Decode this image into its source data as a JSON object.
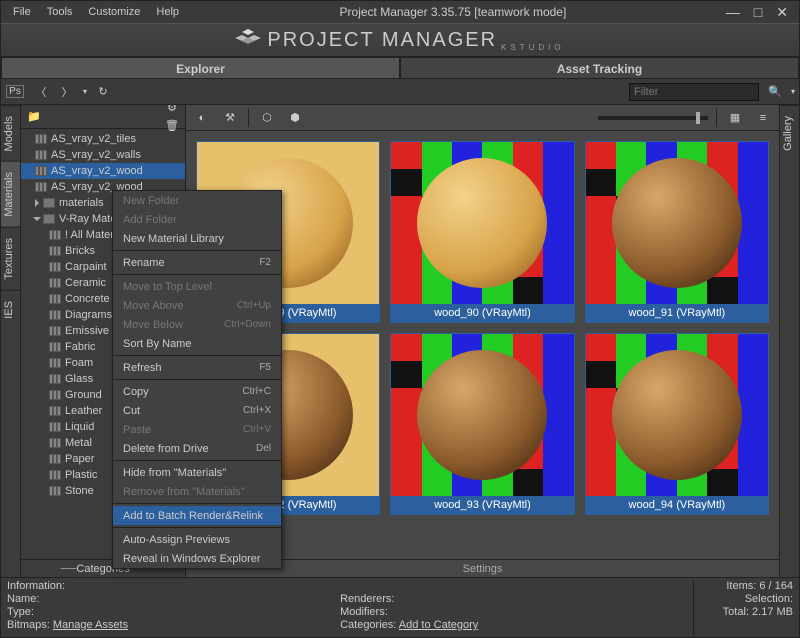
{
  "window": {
    "title": "Project Manager 3.35.75  [teamwork mode]",
    "menu": [
      "File",
      "Tools",
      "Customize",
      "Help"
    ],
    "logo_text": "PROJECT MANAGER",
    "logo_sub": "KSTUDIO"
  },
  "main_tabs": {
    "explorer": "Explorer",
    "asset_tracking": "Asset Tracking",
    "active": "explorer"
  },
  "nav": {
    "filter_placeholder": "Filter"
  },
  "side_tabs": {
    "left": [
      "Models",
      "Materials",
      "Textures",
      "IES"
    ],
    "left_active": 1,
    "right": [
      "Gallery"
    ]
  },
  "tree": {
    "items": [
      {
        "level": 0,
        "label": "AS_vray_v2_tiles",
        "icon": "mat"
      },
      {
        "level": 0,
        "label": "AS_vray_v2_walls",
        "icon": "mat"
      },
      {
        "level": 0,
        "label": "AS_vray_v2_wood",
        "icon": "mat",
        "selected": true
      },
      {
        "level": 0,
        "label": "AS_vray_v2_wood",
        "icon": "mat"
      },
      {
        "level": 0,
        "label": "materials",
        "icon": "folder",
        "expander": "closed"
      },
      {
        "level": 0,
        "label": "V-Ray Materials",
        "icon": "folder",
        "expander": "open"
      },
      {
        "level": 1,
        "label": "! All Materials",
        "icon": "mat"
      },
      {
        "level": 1,
        "label": "Bricks",
        "icon": "mat"
      },
      {
        "level": 1,
        "label": "Carpaint",
        "icon": "mat"
      },
      {
        "level": 1,
        "label": "Ceramic",
        "icon": "mat"
      },
      {
        "level": 1,
        "label": "Concrete",
        "icon": "mat"
      },
      {
        "level": 1,
        "label": "Diagrams",
        "icon": "mat"
      },
      {
        "level": 1,
        "label": "Emissive",
        "icon": "mat"
      },
      {
        "level": 1,
        "label": "Fabric",
        "icon": "mat"
      },
      {
        "level": 1,
        "label": "Foam",
        "icon": "mat"
      },
      {
        "level": 1,
        "label": "Glass",
        "icon": "mat"
      },
      {
        "level": 1,
        "label": "Ground",
        "icon": "mat"
      },
      {
        "level": 1,
        "label": "Leather",
        "icon": "mat"
      },
      {
        "level": 1,
        "label": "Liquid",
        "icon": "mat"
      },
      {
        "level": 1,
        "label": "Metal",
        "icon": "mat"
      },
      {
        "level": 1,
        "label": "Paper",
        "icon": "mat"
      },
      {
        "level": 1,
        "label": "Plastic",
        "icon": "mat"
      },
      {
        "level": 1,
        "label": "Stone",
        "icon": "mat"
      }
    ],
    "categories_label": "Categories"
  },
  "thumbs": {
    "settings_label": "Settings",
    "items": [
      {
        "caption": "wood_89 (VRayMtl)",
        "bg": "plain",
        "sphere": "light"
      },
      {
        "caption": "wood_90 (VRayMtl)",
        "bg": "checker",
        "sphere": "light"
      },
      {
        "caption": "wood_91 (VRayMtl)",
        "bg": "checker",
        "sphere": "dark"
      },
      {
        "caption": "wood_92 (VRayMtl)",
        "bg": "plain",
        "sphere": "dark"
      },
      {
        "caption": "wood_93 (VRayMtl)",
        "bg": "checker",
        "sphere": "dark"
      },
      {
        "caption": "wood_94 (VRayMtl)",
        "bg": "checker",
        "sphere": "dark"
      }
    ]
  },
  "info": {
    "header": "Information:",
    "name": "Name:",
    "type": "Type:",
    "bitmaps": "Bitmaps:",
    "manage_assets": "Manage Assets",
    "renderers": "Renderers:",
    "modifiers": "Modifiers:",
    "categories": "Categories:",
    "add_to_category": "Add to Category",
    "items_label": "Items:",
    "items_value": "6 / 164",
    "selection_label": "Selection:",
    "selection_value": "",
    "total_label": "Total:",
    "total_value": "2.17 MB"
  },
  "context_menu": {
    "highlight": 18,
    "items": [
      {
        "label": "New Folder",
        "disabled": true
      },
      {
        "label": "Add Folder",
        "disabled": true
      },
      {
        "label": "New Material Library"
      },
      {
        "sep": true
      },
      {
        "label": "Rename",
        "shortcut": "F2"
      },
      {
        "sep": true
      },
      {
        "label": "Move to Top Level",
        "disabled": true
      },
      {
        "label": "Move Above",
        "shortcut": "Ctrl+Up",
        "disabled": true
      },
      {
        "label": "Move Below",
        "shortcut": "Ctrl+Down",
        "disabled": true
      },
      {
        "label": "Sort By Name"
      },
      {
        "sep": true
      },
      {
        "label": "Refresh",
        "shortcut": "F5"
      },
      {
        "sep": true
      },
      {
        "label": "Copy",
        "shortcut": "Ctrl+C"
      },
      {
        "label": "Cut",
        "shortcut": "Ctrl+X"
      },
      {
        "label": "Paste",
        "shortcut": "Ctrl+V",
        "disabled": true
      },
      {
        "label": "Delete from Drive",
        "shortcut": "Del"
      },
      {
        "sep": true
      },
      {
        "label": "Hide from \"Materials\""
      },
      {
        "label": "Remove from \"Materials\"",
        "disabled": true
      },
      {
        "sep": true
      },
      {
        "label": "Add to Batch Render&Relink"
      },
      {
        "sep": true
      },
      {
        "label": "Auto-Assign Previews"
      },
      {
        "label": "Reveal in Windows Explorer"
      }
    ]
  }
}
